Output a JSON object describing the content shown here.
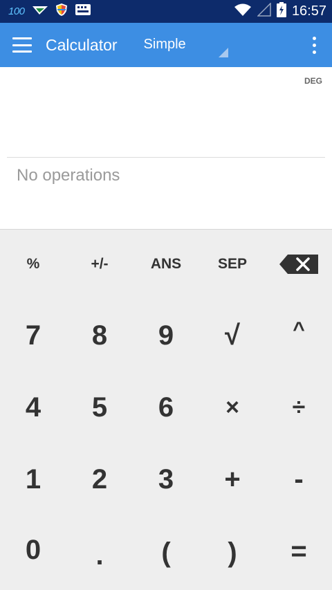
{
  "status_bar": {
    "notification_count": "100",
    "time": "16:57",
    "icons": [
      "send-icon",
      "shield-icon",
      "keyboard-icon",
      "wifi-icon",
      "signal-icon",
      "battery-charging-icon"
    ]
  },
  "app_bar": {
    "title": "Calculator",
    "mode": "Simple",
    "icons": [
      "menu-icon",
      "overflow-menu-icon",
      "dropdown-triangle-icon"
    ]
  },
  "display": {
    "angle_mode": "DEG",
    "history_text": "No operations"
  },
  "keypad": {
    "row1": [
      "%",
      "+/-",
      "ANS",
      "SEP"
    ],
    "row2": [
      "7",
      "8",
      "9",
      "√",
      "^"
    ],
    "row3": [
      "4",
      "5",
      "6",
      "×",
      "÷"
    ],
    "row4": [
      "1",
      "2",
      "3",
      "+",
      "-"
    ],
    "row5": [
      "0",
      ".",
      "(",
      ")",
      "="
    ],
    "backspace_icon": "backspace-icon"
  },
  "colors": {
    "status_bar": "#0d2b6b",
    "app_bar": "#3d8ee3",
    "keypad_background": "#eeeeee",
    "key_text": "#333333"
  }
}
